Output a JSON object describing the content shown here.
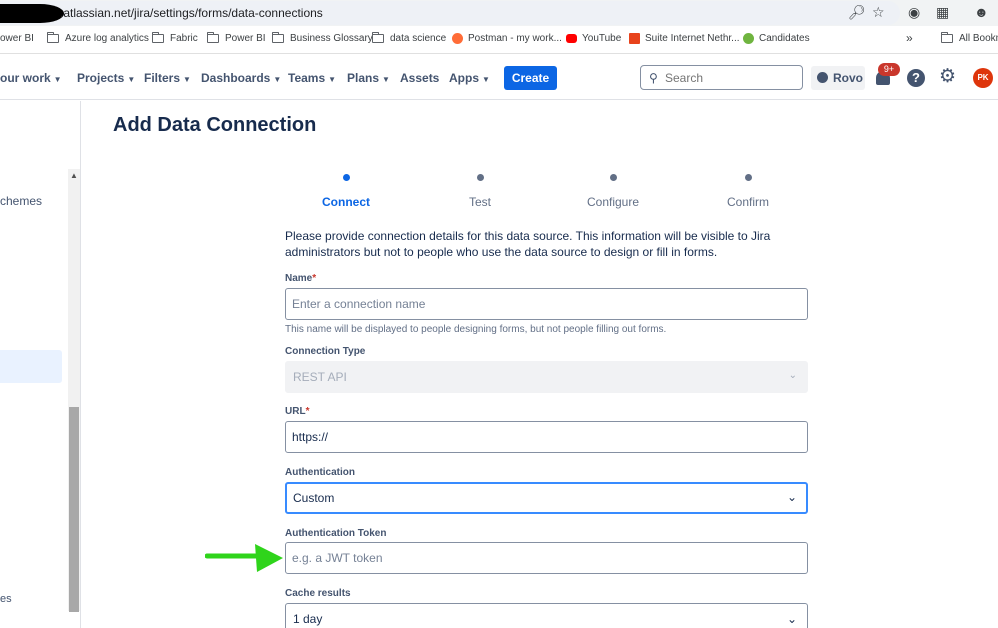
{
  "browser": {
    "url_path": ".atlassian.net/jira/settings/forms/data-connections",
    "bookmarks": [
      {
        "label": "ower BI",
        "icon": "folder-icon"
      },
      {
        "label": "Azure log analytics",
        "icon": "folder-icon"
      },
      {
        "label": "Fabric",
        "icon": "folder-icon"
      },
      {
        "label": "Power BI",
        "icon": "folder-icon"
      },
      {
        "label": "Business Glossary",
        "icon": "folder-icon"
      },
      {
        "label": "data science",
        "icon": "folder-icon"
      },
      {
        "label": "Postman - my work...",
        "icon": "postman-icon"
      },
      {
        "label": "YouTube",
        "icon": "youtube-icon"
      },
      {
        "label": "Suite Internet Nethr...",
        "icon": "suite-icon"
      },
      {
        "label": "Candidates",
        "icon": "candidates-icon"
      },
      {
        "label": "All Bookm",
        "icon": "folder-icon"
      }
    ],
    "overflow_label": "»"
  },
  "nav": {
    "items": [
      {
        "label": "our work"
      },
      {
        "label": "Projects"
      },
      {
        "label": "Filters"
      },
      {
        "label": "Dashboards"
      },
      {
        "label": "Teams"
      },
      {
        "label": "Plans"
      },
      {
        "label": "Assets"
      },
      {
        "label": "Apps"
      }
    ],
    "create_label": "Create",
    "search_placeholder": "Search",
    "rovo_label": "Rovo",
    "notification_count": "9+",
    "help_label": "?",
    "avatar_initials": "PK"
  },
  "sidebar": {
    "item_schemes": "chemes",
    "item_bottom": "es"
  },
  "main": {
    "title": "Add Data Connection",
    "steps": [
      {
        "label": "Connect",
        "active": true
      },
      {
        "label": "Test",
        "active": false
      },
      {
        "label": "Configure",
        "active": false
      },
      {
        "label": "Confirm",
        "active": false
      }
    ],
    "intro": "Please provide connection details for this data source. This information will be visible to Jira administrators but not to people who use the data source to design or fill in forms.",
    "required_mark": "*",
    "name": {
      "label": "Name",
      "placeholder": "Enter a connection name",
      "help": "This name will be displayed to people designing forms, but not people filling out forms."
    },
    "connection_type": {
      "label": "Connection Type",
      "value": "REST API"
    },
    "url": {
      "label": "URL",
      "value": "https://"
    },
    "authentication": {
      "label": "Authentication",
      "value": "Custom"
    },
    "auth_token": {
      "label": "Authentication Token",
      "placeholder": "e.g. a JWT token"
    },
    "cache": {
      "label": "Cache results",
      "value": "1 day"
    }
  },
  "colors": {
    "primary": "#0c66e4",
    "annotation_arrow": "#2fd41b",
    "badge": "#c9372c",
    "avatar": "#de350b"
  }
}
